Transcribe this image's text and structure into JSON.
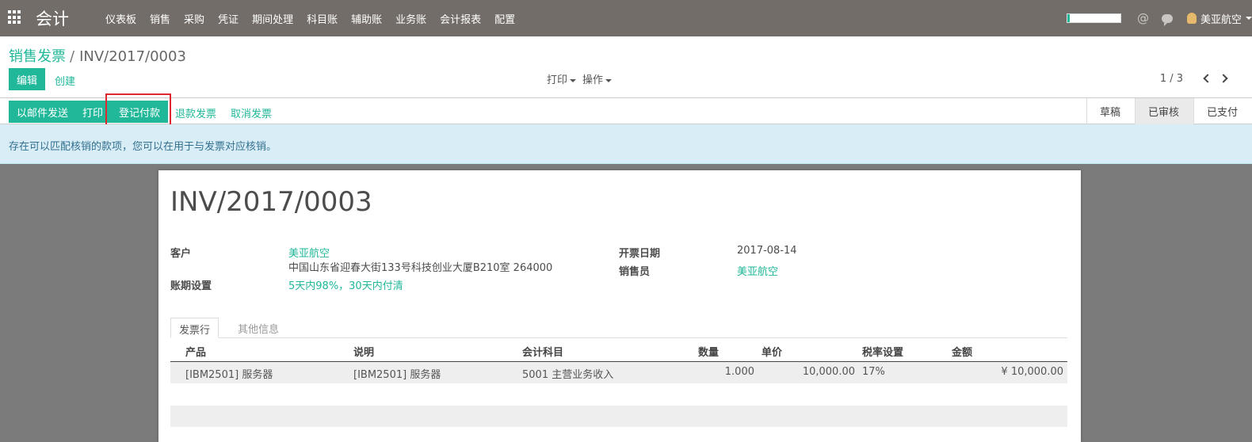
{
  "navbar": {
    "brand": "会计",
    "menu": [
      "仪表板",
      "销售",
      "采购",
      "凭证",
      "期间处理",
      "科目账",
      "辅助账",
      "业务账",
      "会计报表",
      "配置"
    ],
    "user": "美亚航空",
    "progress_fraction": 0.05
  },
  "breadcrumb": {
    "parent": "销售发票",
    "separator": "/",
    "current": "INV/2017/0003"
  },
  "control": {
    "edit_label": "编辑",
    "create_label": "创建",
    "print_label": "打印",
    "action_label": "操作",
    "pager": "1 / 3"
  },
  "statusbar": {
    "send_email": "以邮件发送",
    "print": "打印",
    "register_payment": "登记付款",
    "refund": "退款发票",
    "cancel": "取消发票",
    "steps": [
      "草稿",
      "已审核",
      "已支付"
    ]
  },
  "alert": {
    "text": "存在可以匹配核销的款项，您可以在用于与发票对应核销。"
  },
  "invoice": {
    "number": "INV/2017/0003",
    "customer_label": "客户",
    "customer_name": "美亚航空",
    "customer_address": "中国山东省迎春大街133号科技创业大厦B210室 264000",
    "payment_term_label": "账期设置",
    "payment_term": "5天内98%，30天内付清",
    "invoice_date_label": "开票日期",
    "invoice_date": "2017-08-14",
    "salesperson_label": "销售员",
    "salesperson": "美亚航空"
  },
  "tabs": [
    "发票行",
    "其他信息"
  ],
  "table": {
    "headers": [
      "产品",
      "说明",
      "会计科目",
      "数量",
      "单价",
      "税率设置",
      "金额"
    ],
    "rows": [
      [
        "[IBM2501] 服务器",
        "[IBM2501] 服务器",
        "5001 主营业务收入",
        "1.000",
        "10,000.00",
        "17%",
        "¥ 10,000.00"
      ]
    ]
  }
}
